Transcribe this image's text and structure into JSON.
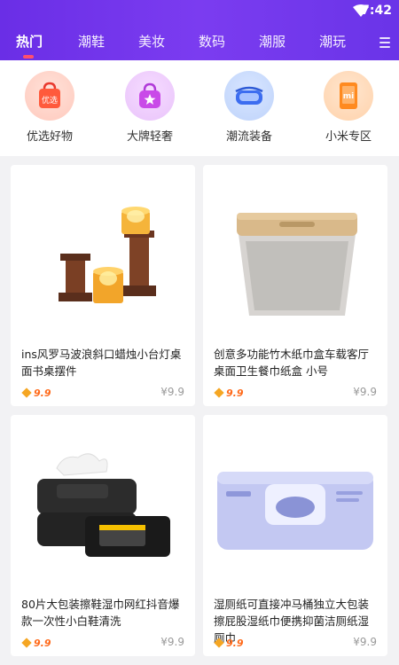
{
  "status": {
    "time": "7:42"
  },
  "tabs": [
    {
      "label": "热门"
    },
    {
      "label": "潮鞋"
    },
    {
      "label": "美妆"
    },
    {
      "label": "数码"
    },
    {
      "label": "潮服"
    },
    {
      "label": "潮玩"
    }
  ],
  "categories": [
    {
      "label": "优选好物",
      "icon": "shopping-bag-icon",
      "icon_text": "优选"
    },
    {
      "label": "大牌轻奢",
      "icon": "handbag-star-icon"
    },
    {
      "label": "潮流装备",
      "icon": "vr-headset-icon"
    },
    {
      "label": "小米专区",
      "icon": "xiaomi-phone-icon",
      "icon_text": "mi"
    }
  ],
  "products": [
    {
      "title": "ins风罗马波浪斜口蜡烛小台灯桌面书桌摆件",
      "badge": "9.9",
      "price": "¥9.9"
    },
    {
      "title": "创意多功能竹木纸巾盒车载客厅桌面卫生餐巾纸盒 小号",
      "badge": "9.9",
      "price": "¥9.9"
    },
    {
      "title": "80片大包装擦鞋湿巾网红抖音爆款一次性小白鞋清洗",
      "badge": "9.9",
      "price": "¥9.9"
    },
    {
      "title": "湿厕纸可直接冲马桶独立大包装擦屁股湿纸巾便携抑菌洁厕纸湿厕巾",
      "badge": "9.9",
      "price": "¥9.9"
    }
  ],
  "colors": {
    "header": "#6a2ee6",
    "accent": "#ff4f6e",
    "badge": "#ff6a1a"
  }
}
